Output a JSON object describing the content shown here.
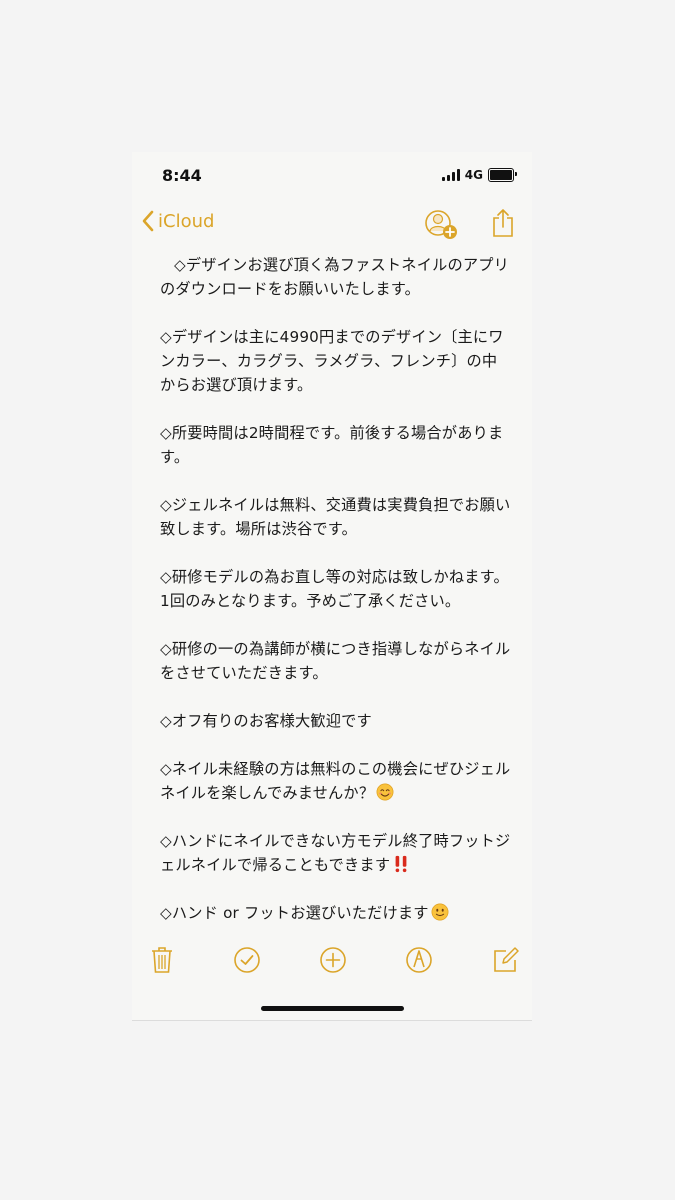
{
  "status": {
    "time": "8:44",
    "network": "4G",
    "battery_level": 1.0
  },
  "nav": {
    "back_label": "iCloud",
    "back_icon": "chevron-left-icon",
    "share_people_icon": "add-person-icon",
    "share_icon": "share-icon"
  },
  "note": {
    "paragraphs": [
      "◇デザインお選び頂く為ファストネイルのアプリのダウンロードをお願いいたします。",
      "◇デザインは主に4990円までのデザイン〔主にワンカラー、カラグラ、ラメグラ、フレンチ〕の中からお選び頂けます。",
      "◇所要時間は2時間程です。前後する場合があります。",
      "◇ジェルネイルは無料、交通費は実費負担でお願い致します。場所は渋谷です。",
      "◇研修モデルの為お直し等の対応は致しかねます。1回のみとなります。予めご了承ください。",
      "◇研修の一の為講師が横につき指導しながらネイルをさせていただきます。",
      "◇オフ有りのお客様大歓迎です",
      "◇ネイル未経験の方は無料のこの機会にぜひジェルネイルを楽しんでみませんか？",
      "◇ハンドにネイルできない方モデル終了時フットジェルネイルで帰ることもできます",
      "◇ハンド or フットお選びいただけます"
    ],
    "emoji": {
      "p8": "smiling-face-emoji",
      "p9": "double-exclamation-emoji",
      "p10": "slight-smile-emoji"
    }
  },
  "toolbar": {
    "items": [
      "trash-icon",
      "checklist-icon",
      "add-icon",
      "markup-icon",
      "compose-icon"
    ]
  },
  "colors": {
    "accent": "#dba52a",
    "text": "#1a1a1a",
    "paper": "#f7f7f5",
    "background": "#f4f4f4",
    "exclamation": "#d92a1c"
  }
}
